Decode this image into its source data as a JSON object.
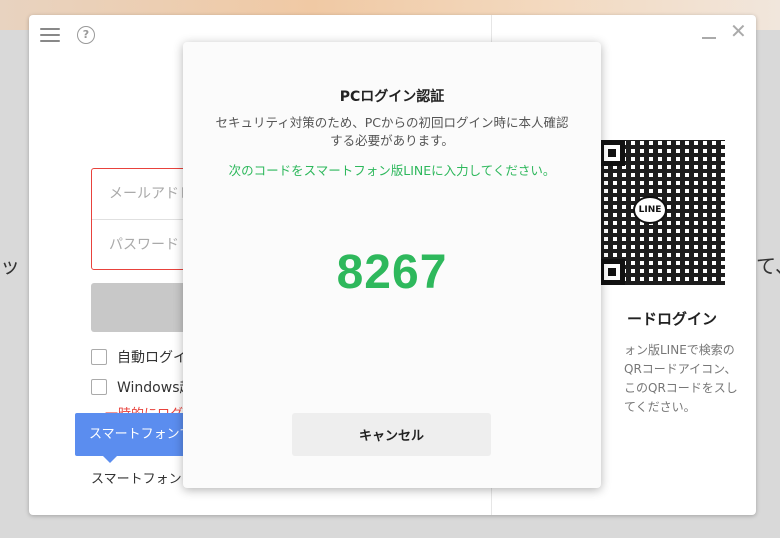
{
  "background": {
    "left_text": "ッ",
    "right_text": "て、"
  },
  "main_window": {
    "email_placeholder": "メールアドレス",
    "password_placeholder": "パスワード",
    "auto_login_label": "自動ログイン",
    "windows_startup_label": "Windows起",
    "temporary_login_text": "一時的にログイン",
    "tooltip_text": "スマートフォンで本",
    "phone_login_link": "スマートフォンを使",
    "qr_logo_text": "LINE",
    "qr_title": "ードログイン",
    "qr_description": "ォン版LINEで検索のQRコードアイコン、このQRコードをスしてください。"
  },
  "dialog": {
    "title": "PCログイン認証",
    "message": "セキュリティ対策のため、PCからの初回ログイン時に本人確認する必要があります。",
    "instruction": "次のコードをスマートフォン版LINEに入力してください。",
    "code": "8267",
    "cancel_label": "キャンセル"
  },
  "colors": {
    "accent_green": "#2eb85c",
    "error_red": "#e8423c",
    "tooltip_blue": "#5b8def"
  }
}
